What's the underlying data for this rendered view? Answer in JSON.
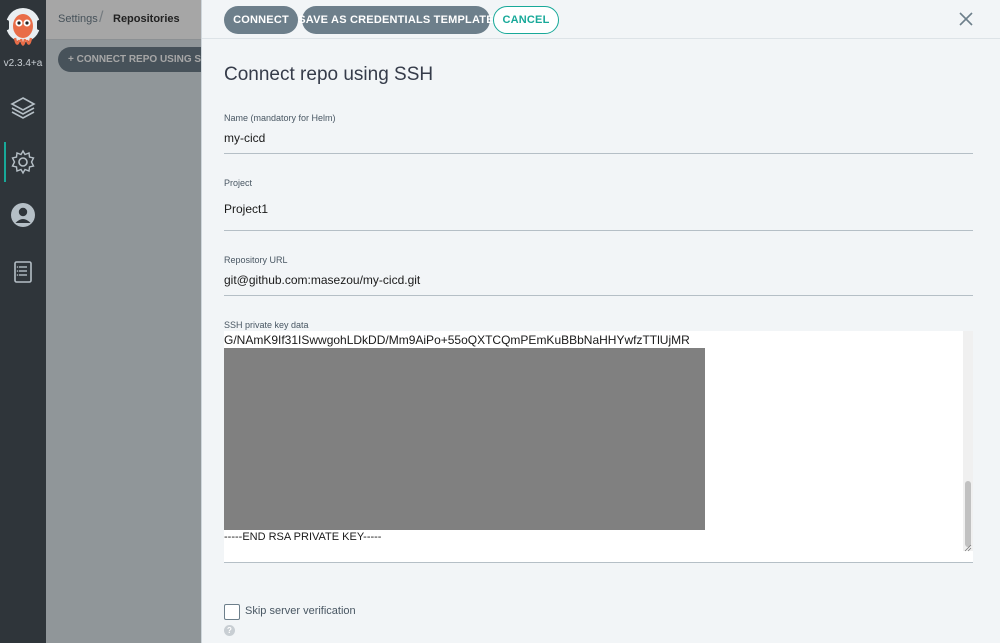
{
  "nav": {
    "version": "v2.3.4+a",
    "items": [
      {
        "icon": "layers-icon",
        "label": ""
      },
      {
        "icon": "gear-icon",
        "label": ""
      },
      {
        "icon": "user-icon",
        "label": ""
      },
      {
        "icon": "docs-icon",
        "label": ""
      }
    ],
    "active_item": "gear-icon"
  },
  "breadcrumb": {
    "parent": "Settings",
    "current": "Repositories"
  },
  "background": {
    "connect_button": "+ CONNECT REPO USING SS"
  },
  "panel": {
    "buttons": {
      "connect": "CONNECT",
      "save_template": "SAVE AS CREDENTIALS TEMPLATE",
      "cancel": "CANCEL"
    },
    "title": "Connect repo using SSH",
    "fields": {
      "name": {
        "label": "Name (mandatory for Helm)",
        "value": "my-cicd"
      },
      "project": {
        "label": "Project",
        "value": "Project1"
      },
      "repo_url": {
        "label": "Repository URL",
        "value": "git@github.com:masezou/my-cicd.git"
      },
      "ssh_key": {
        "label": "SSH private key data",
        "first_visible_line": "G/NAmK9If31ISwwgohLDkDD/Mm9AiPo+55oQXTCQmPEmKuBBbNaHHYwfzTTlUjMR",
        "last_line": "-----END RSA PRIVATE KEY-----"
      }
    },
    "skip_verification": {
      "label": "Skip server verification",
      "checked": false
    },
    "help_icon": "?"
  },
  "colors": {
    "nav_bg": "#2f353a",
    "accent": "#18a999",
    "primary_button": "#6d7f8b",
    "panel_bg": "#f2f5f7"
  }
}
